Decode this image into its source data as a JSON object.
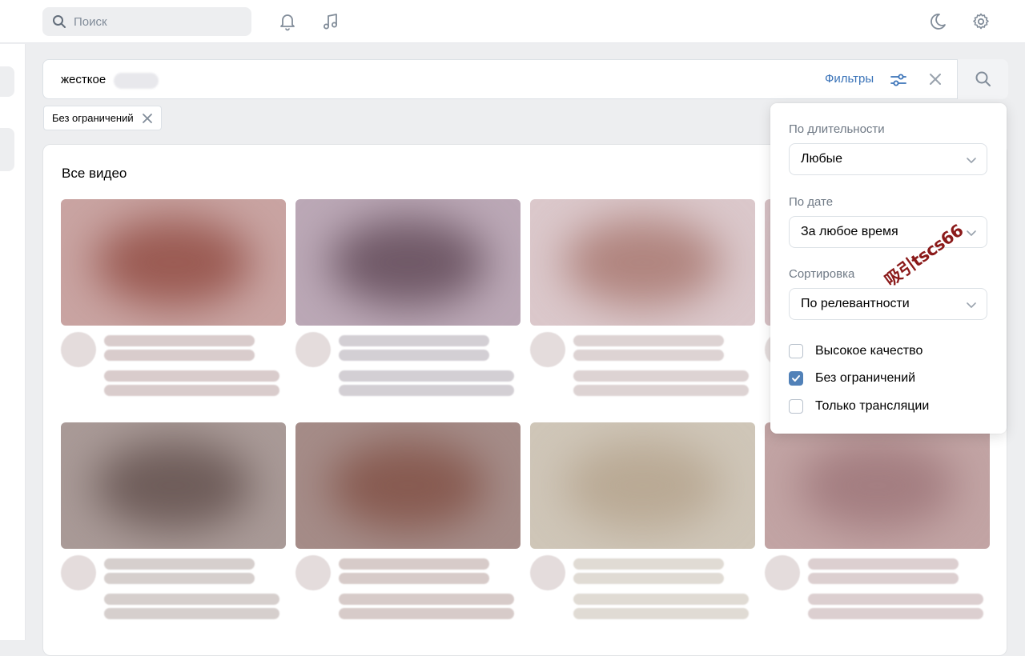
{
  "header": {
    "search_placeholder": "Поиск",
    "icons": [
      "search-icon",
      "bell-icon",
      "music-icon",
      "moon-icon",
      "gear-icon"
    ]
  },
  "search": {
    "query": "жесткое",
    "filters_label": "Фильтры"
  },
  "active_tags": [
    {
      "label": "Без ограничений"
    }
  ],
  "section": {
    "title": "Все видео"
  },
  "filters": {
    "duration": {
      "label": "По длительности",
      "value": "Любые"
    },
    "date": {
      "label": "По дате",
      "value": "За любое время"
    },
    "sort": {
      "label": "Сортировка",
      "value": "По релевантности"
    },
    "checkboxes": [
      {
        "label": "Высокое качество",
        "checked": false
      },
      {
        "label": "Без ограничений",
        "checked": true
      },
      {
        "label": "Только трансляции",
        "checked": false
      }
    ]
  },
  "watermark": "吸引tscs66",
  "colors": {
    "accent": "#5181b8",
    "link": "#3a73b8",
    "background": "#edeef0"
  },
  "videos": [
    {
      "thumb_bg": "#c9a4a2",
      "thumb_glow": "#9a5a52",
      "line_color": "#d9cccc"
    },
    {
      "thumb_bg": "#bba8b6",
      "thumb_glow": "#6f5866",
      "line_color": "#d3cfd4"
    },
    {
      "thumb_bg": "#dbc8cb",
      "thumb_glow": "#b0847e",
      "line_color": "#ddd3d3"
    },
    {
      "thumb_bg": "#d6c0c4",
      "thumb_glow": "#a87f82",
      "line_color": "#ddd3d5"
    },
    {
      "thumb_bg": "#a99a97",
      "thumb_glow": "#6e5c59",
      "line_color": "#d6cfcd"
    },
    {
      "thumb_bg": "#a58c88",
      "thumb_glow": "#875a50",
      "line_color": "#d7cbc9"
    },
    {
      "thumb_bg": "#cfc6b8",
      "thumb_glow": "#b9a994",
      "line_color": "#e0dbd4"
    },
    {
      "thumb_bg": "#c2a4a4",
      "thumb_glow": "#a37d80",
      "line_color": "#dccfd0"
    }
  ]
}
